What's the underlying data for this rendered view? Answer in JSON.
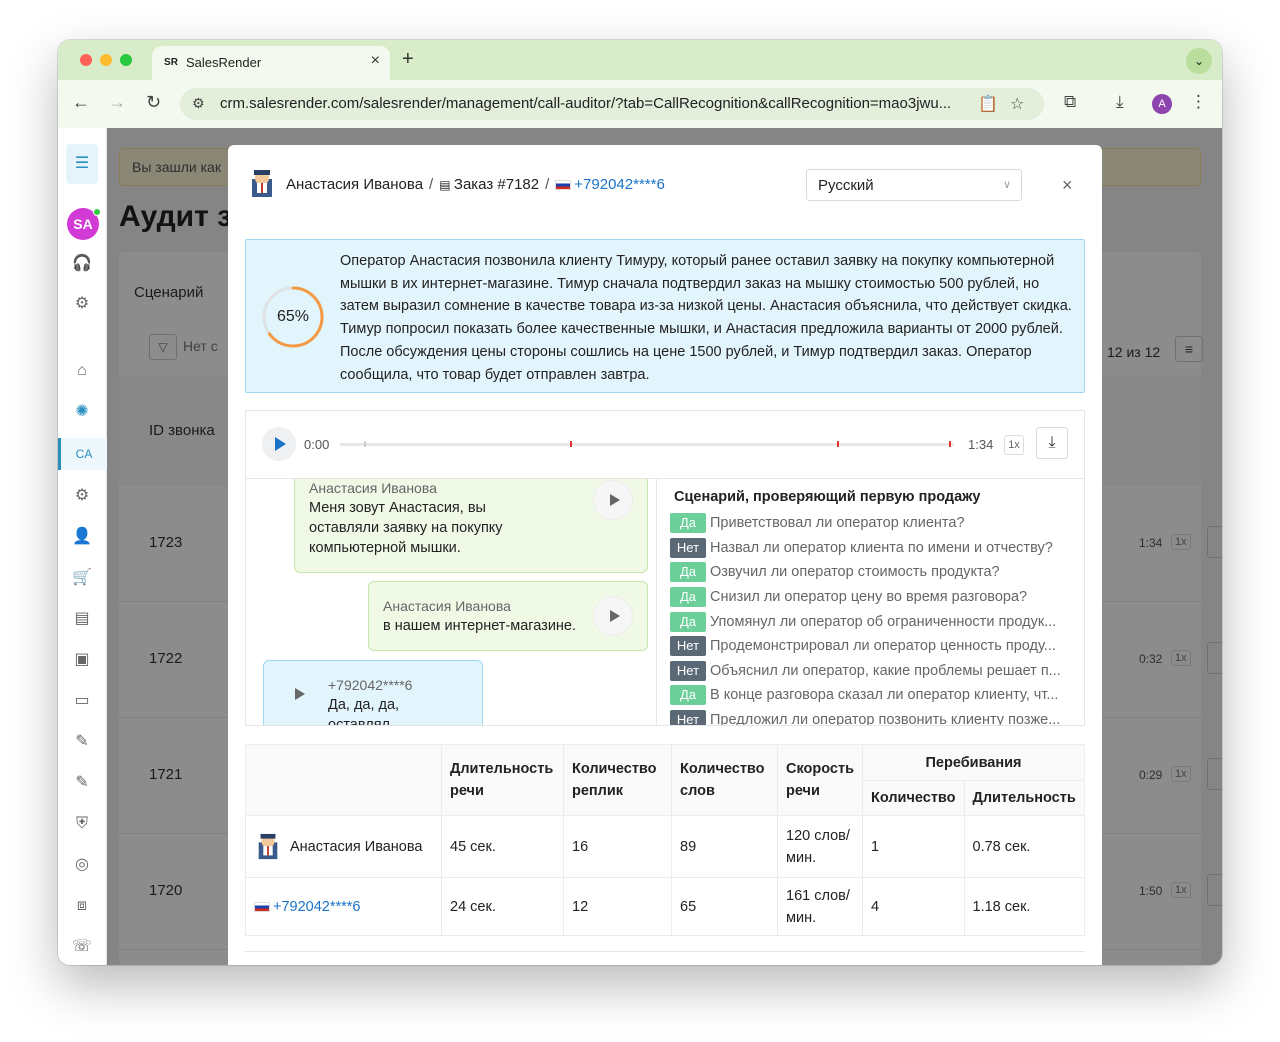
{
  "browser": {
    "tab_favicon": "SR",
    "tab_title": "SalesRender",
    "url": "crm.salesrender.com/salesrender/management/call-auditor/?tab=CallRecognition&callRecognition=mao3jwu...",
    "profile_initial": "A"
  },
  "sidebar": {
    "avatar_initials": "SA",
    "active_label": "CA",
    "accent_color": "#2a8fbd"
  },
  "background": {
    "banner_text": "Вы зашли как",
    "page_title": "Аудит з",
    "card_label": "Сценарий",
    "filter_text": "Нет с",
    "counter": "12 из 12",
    "column_id": "ID звонка",
    "rows": [
      {
        "id": "1723",
        "duration": "1:34",
        "speed": "1x"
      },
      {
        "id": "1722",
        "duration": "0:32",
        "speed": "1x"
      },
      {
        "id": "1721",
        "duration": "0:29",
        "speed": "1x"
      },
      {
        "id": "1720",
        "duration": "1:50",
        "speed": "1x"
      }
    ]
  },
  "modal": {
    "operator_name": "Анастасия Иванова",
    "order_label": "Заказ #7182",
    "separator": "/",
    "phone": "+792042****6",
    "language": "Русский",
    "close_symbol": "×",
    "summary": {
      "percent": "65%",
      "percent_value": 0.65,
      "text": "Оператор Анастасия позвонила клиенту Тимуру, который ранее оставил заявку на покупку компьютерной мышки в их интернет-магазине. Тимур сначала подтвердил заказ на мышку стоимостью 500 рублей, но затем выразил сомнение в качестве товара из-за низкой цены. Анастасия объяснила, что действует скидка. Тимур попросил показать более качественные мышки, и Анастасия предложила варианты от 2000 рублей. После обсуждения цены стороны сошлись на цене 1500 рублей, и Тимур подтвердил заказ. Оператор сообщила, что товар будет отправлен завтра."
    },
    "player": {
      "current_time": "0:00",
      "total_time": "1:34",
      "speed": "1x"
    },
    "chat": [
      {
        "author": "Анастасия Иванова",
        "text": "Меня зовут Анастасия, вы оставляли заявку на покупку компьютерной мышки."
      },
      {
        "author": "Анастасия Иванова",
        "text": "в нашем интернет-магазине."
      },
      {
        "author": "+792042****6",
        "text": "Да, да, да, оставлял."
      }
    ],
    "script": {
      "title": "Сценарий, проверяющий первую продажу",
      "yes_label": "Да",
      "no_label": "Нет",
      "items": [
        {
          "answer": "Да",
          "question": "Приветствовал ли оператор клиента?"
        },
        {
          "answer": "Нет",
          "question": "Назвал ли оператор клиента по имени и отчеству?"
        },
        {
          "answer": "Да",
          "question": "Озвучил ли оператор стоимость продукта?"
        },
        {
          "answer": "Да",
          "question": "Снизил ли оператор цену во время разговора?"
        },
        {
          "answer": "Да",
          "question": "Упомянул ли оператор об ограниченности продук..."
        },
        {
          "answer": "Нет",
          "question": "Продемонстрировал ли оператор ценность проду..."
        },
        {
          "answer": "Нет",
          "question": "Объяснил ли оператор, какие проблемы решает п..."
        },
        {
          "answer": "Да",
          "question": "В конце разговора сказал ли оператор клиенту, чт..."
        },
        {
          "answer": "Нет",
          "question": "Предложил ли оператор позвонить клиенту позже..."
        }
      ]
    },
    "stats": {
      "headers": {
        "speech_duration": "Длительность речи",
        "replicas": "Количество реплик",
        "words": "Количество слов",
        "speech_rate": "Скорость речи",
        "interruptions": "Перебивания",
        "int_count": "Количество",
        "int_duration": "Длительность"
      },
      "rows": [
        {
          "name": "Анастасия Иванова",
          "speech_duration": "45 сек.",
          "replicas": "16",
          "words": "89",
          "speech_rate": "120 слов/мин.",
          "int_count": "1",
          "int_duration": "0.78 сек."
        },
        {
          "name": "+792042****6",
          "speech_duration": "24 сек.",
          "replicas": "12",
          "words": "65",
          "speech_rate": "161 слов/мин.",
          "int_count": "4",
          "int_duration": "1.18 сек."
        }
      ]
    }
  }
}
